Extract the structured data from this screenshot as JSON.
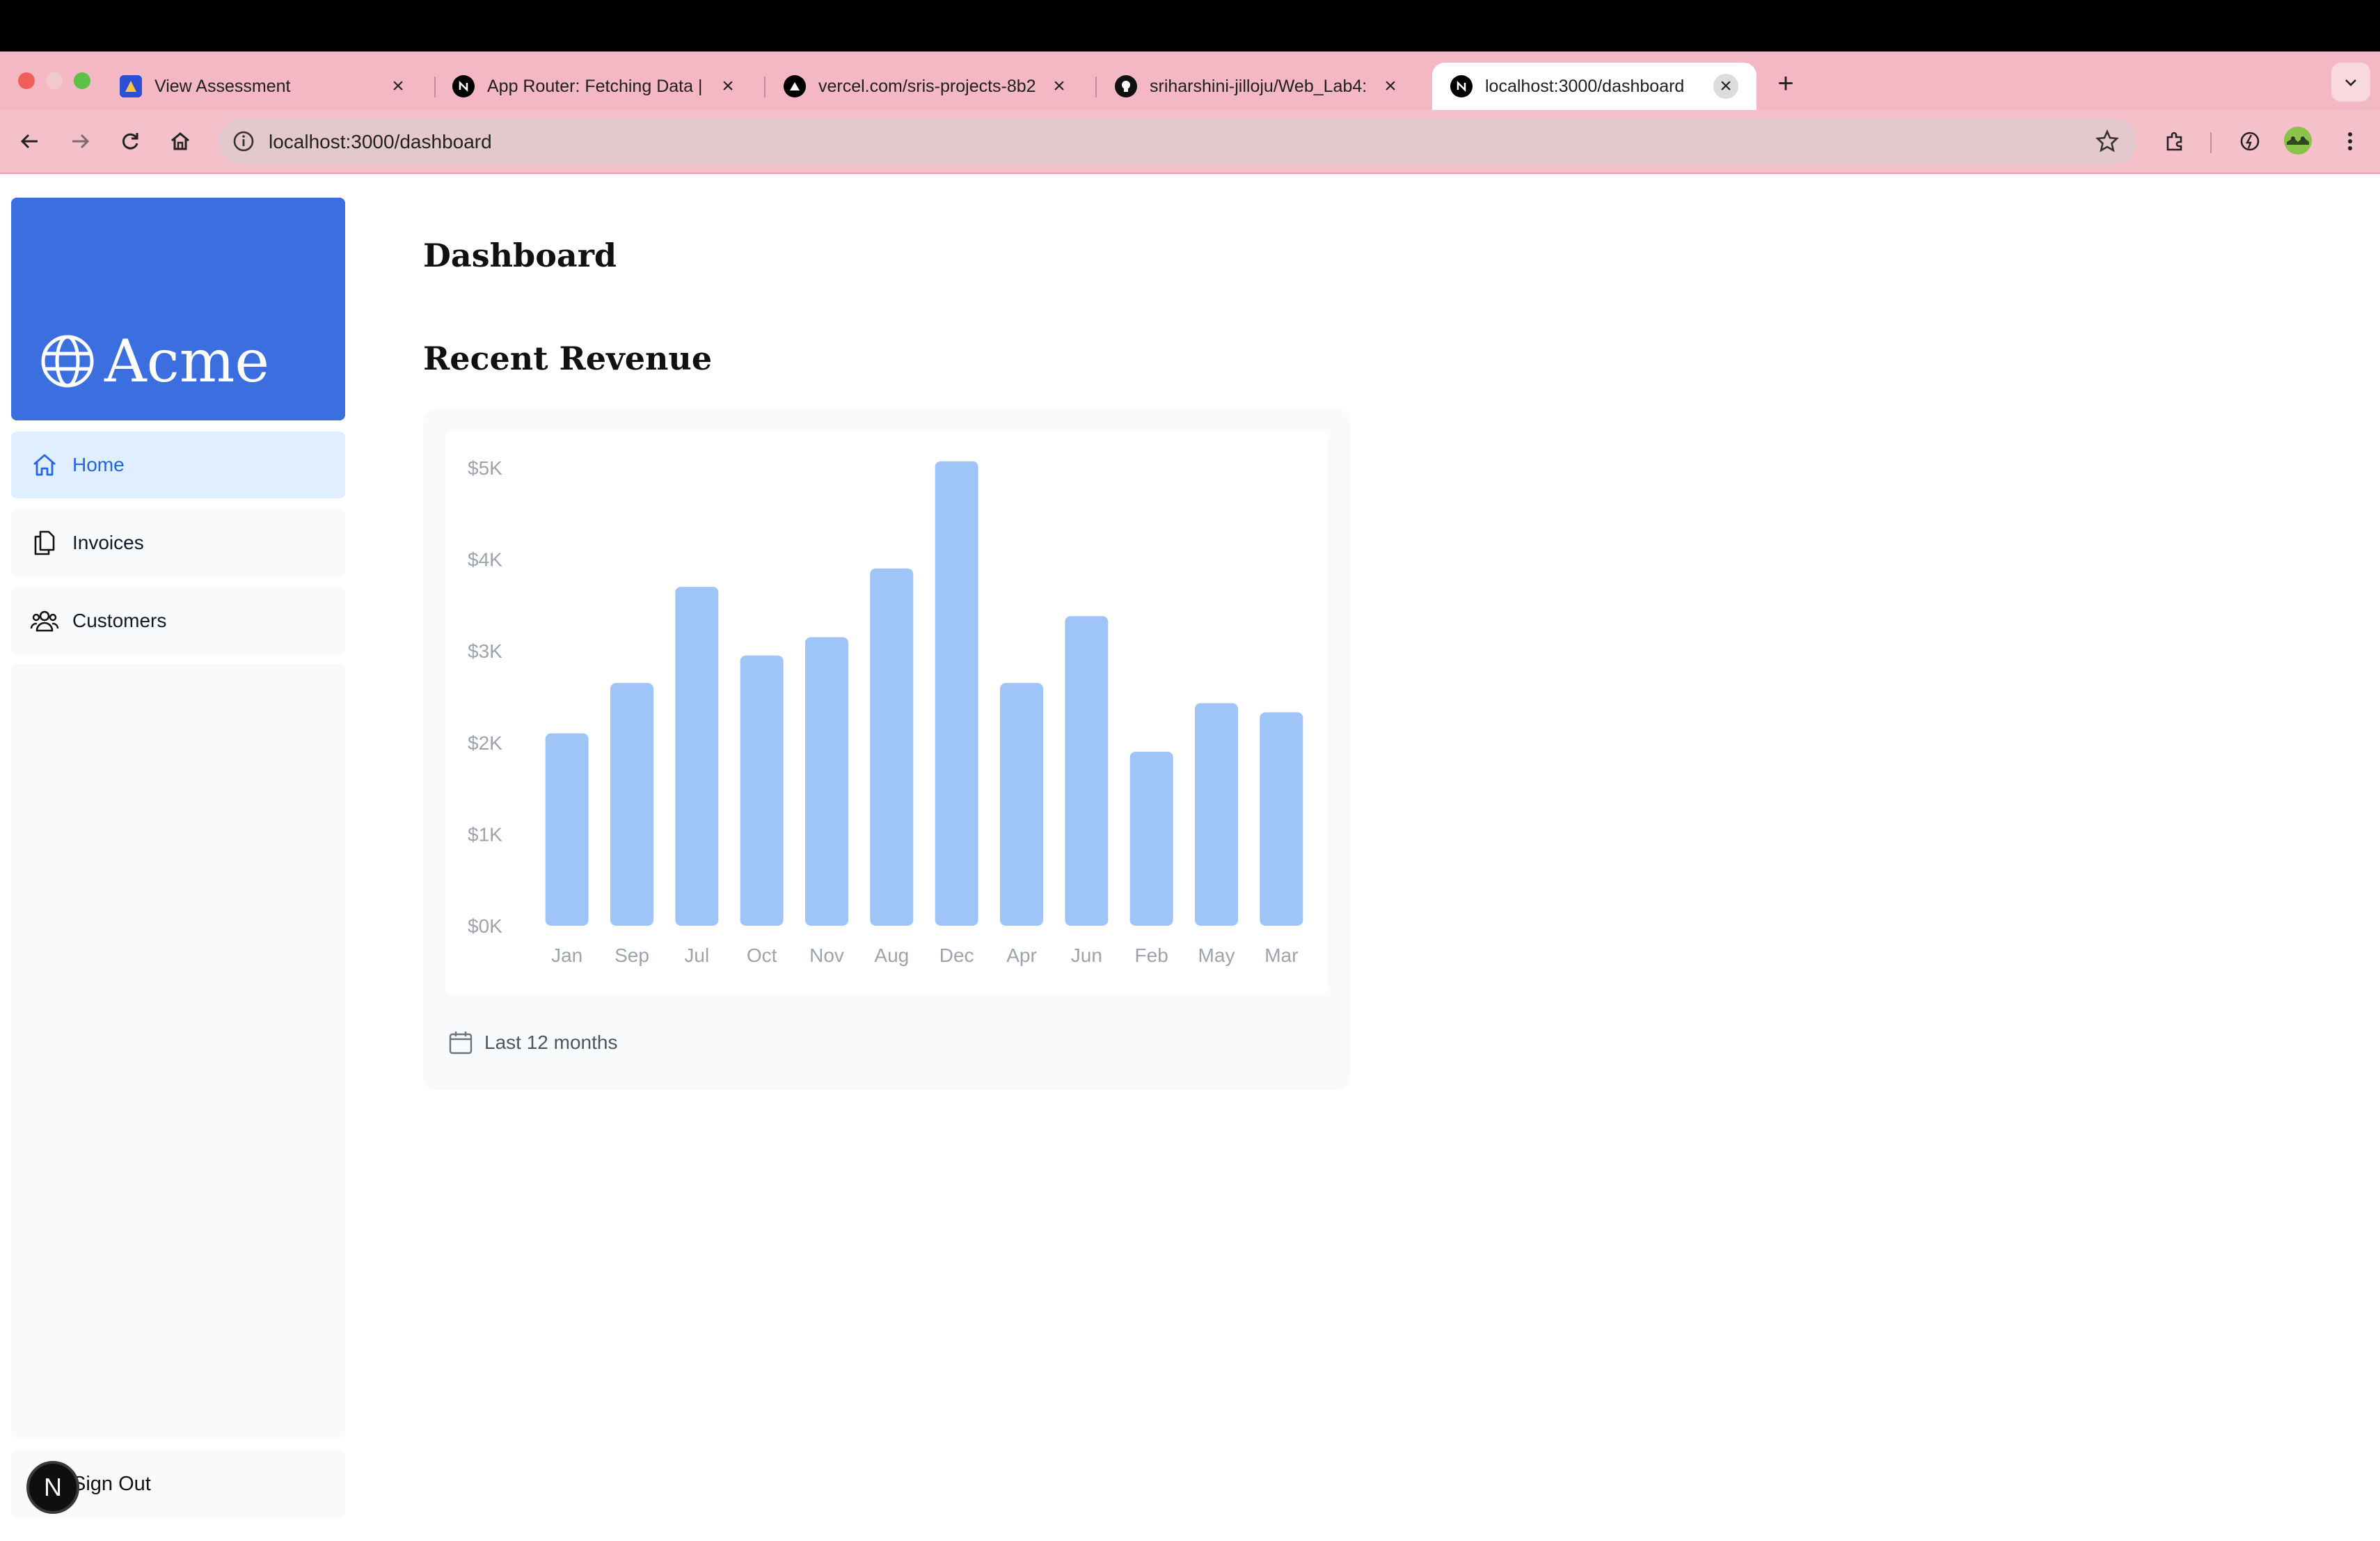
{
  "browser": {
    "tabs": [
      {
        "title": "View Assessment",
        "icon": "assessment-favicon"
      },
      {
        "title": "App Router: Fetching Data | N",
        "icon": "nextjs-favicon"
      },
      {
        "title": "vercel.com/sris-projects-8b2",
        "icon": "vercel-favicon"
      },
      {
        "title": "sriharshini-jilloju/Web_Lab4:",
        "icon": "github-favicon"
      },
      {
        "title": "localhost:3000/dashboard",
        "icon": "nextjs-favicon"
      }
    ],
    "new_tab_label": "+",
    "url": "localhost:3000/dashboard"
  },
  "sidebar": {
    "logo_text": "Acme",
    "nav": [
      {
        "label": "Home",
        "icon": "home-icon"
      },
      {
        "label": "Invoices",
        "icon": "document-duplicate-icon"
      },
      {
        "label": "Customers",
        "icon": "user-group-icon"
      }
    ],
    "sign_out_label": "Sign Out"
  },
  "dev_badge": "N",
  "main": {
    "title": "Dashboard",
    "revenue_title": "Recent Revenue",
    "footer_text": "Last 12 months"
  },
  "colors": {
    "accent": "#3b6fe0",
    "bar": "#9fc5f8",
    "axis_text": "#9ca3af",
    "tab_bar": "#f3b8c3"
  },
  "chart_data": {
    "type": "bar",
    "title": "",
    "xlabel": "",
    "ylabel": "",
    "categories": [
      "Jan",
      "Sep",
      "Jul",
      "Oct",
      "Nov",
      "Aug",
      "Dec",
      "Apr",
      "Jun",
      "Feb",
      "May",
      "Mar"
    ],
    "values": [
      2100,
      2650,
      3700,
      2950,
      3150,
      3900,
      5070,
      2650,
      3380,
      1900,
      2430,
      2330
    ],
    "ylim": [
      0,
      5000
    ],
    "yticks": [
      "$0K",
      "$1K",
      "$2K",
      "$3K",
      "$4K",
      "$5K"
    ],
    "grid": false,
    "legend": "none"
  }
}
